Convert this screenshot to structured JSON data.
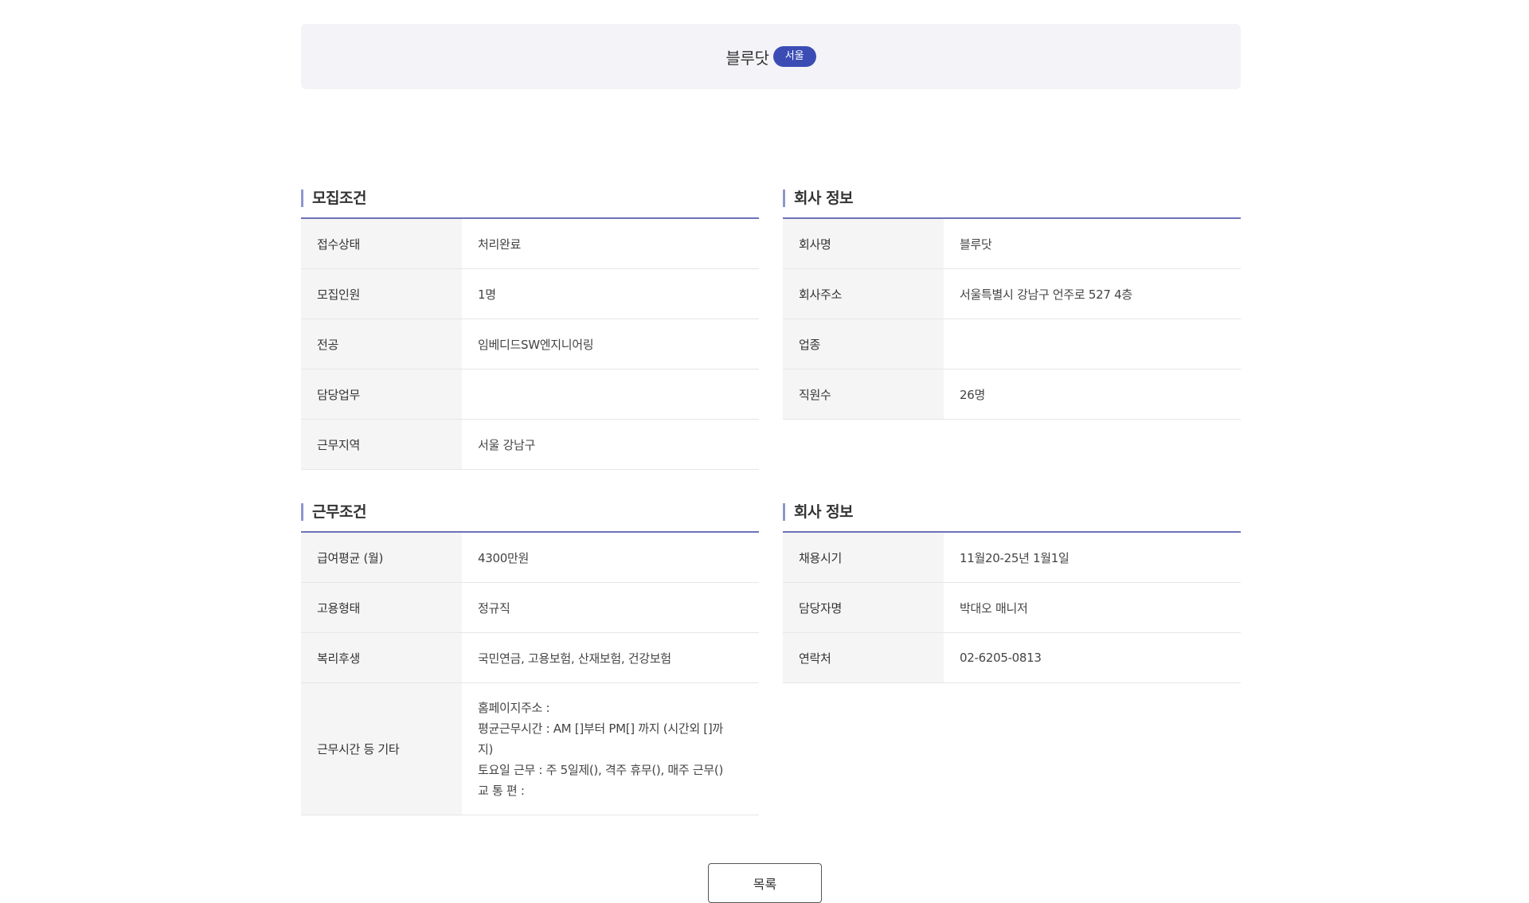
{
  "header": {
    "company_name": "블루닷",
    "region_badge": "서울"
  },
  "sections": {
    "recruit": {
      "title": "모집조건",
      "rows": [
        {
          "label": "접수상태",
          "value": "처리완료"
        },
        {
          "label": "모집인원",
          "value": "1명"
        },
        {
          "label": "전공",
          "value": "임베디드SW엔지니어링"
        },
        {
          "label": "담당업무",
          "value": ""
        },
        {
          "label": "근무지역",
          "value": "서울 강남구"
        }
      ]
    },
    "company": {
      "title": "회사 정보",
      "rows": [
        {
          "label": "회사명",
          "value": "블루닷"
        },
        {
          "label": "회사주소",
          "value": "서울특별시 강남구 언주로 527 4층"
        },
        {
          "label": "업종",
          "value": ""
        },
        {
          "label": "직원수",
          "value": "26명"
        }
      ]
    },
    "work": {
      "title": "근무조건",
      "rows": [
        {
          "label": "급여평균 (월)",
          "value": "4300만원"
        },
        {
          "label": "고용형태",
          "value": "정규직"
        },
        {
          "label": "복리후생",
          "value": "국민연금, 고용보험, 산재보험, 건강보험"
        }
      ],
      "other": {
        "label": "근무시간 등 기타",
        "lines": [
          "홈페이지주소 :",
          "평균근무시간 : AM []부터 PM[] 까지 (시간외 []까",
          "지)",
          "토요일 근무 : 주 5일제(), 격주 휴무(), 매주 근무()",
          "교 통 편 :"
        ]
      }
    },
    "contact": {
      "title": "회사 정보",
      "rows": [
        {
          "label": "채용시기",
          "value": "11월20-25년 1월1일"
        },
        {
          "label": "담당자명",
          "value": "박대오 매니저"
        },
        {
          "label": "연락처",
          "value": "02-6205-0813"
        }
      ]
    }
  },
  "footer": {
    "list_button": "목록"
  },
  "colors": {
    "accent": "#3b4db5",
    "section_line": "#6a73b8",
    "header_bg": "#f4f4f8",
    "label_bg": "#f5f5f5"
  }
}
